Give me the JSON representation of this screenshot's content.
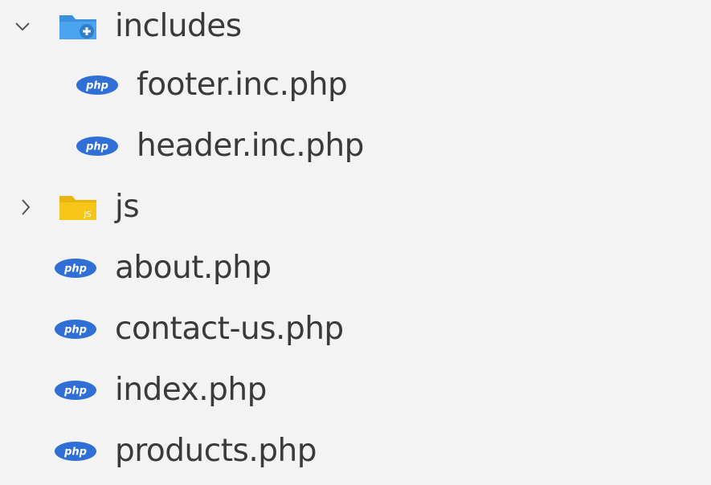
{
  "explorer": {
    "items": [
      {
        "label": "includes",
        "icon": "folder-open-icon",
        "kind": "folder",
        "expanded": true
      },
      {
        "label": "footer.inc.php",
        "icon": "php-file-icon",
        "kind": "file"
      },
      {
        "label": "header.inc.php",
        "icon": "php-file-icon",
        "kind": "file"
      },
      {
        "label": "js",
        "icon": "folder-js-icon",
        "kind": "folder",
        "expanded": false
      },
      {
        "label": "about.php",
        "icon": "php-file-icon",
        "kind": "file"
      },
      {
        "label": "contact-us.php",
        "icon": "php-file-icon",
        "kind": "file"
      },
      {
        "label": "index.php",
        "icon": "php-file-icon",
        "kind": "file"
      },
      {
        "label": "products.php",
        "icon": "php-file-icon",
        "kind": "file"
      }
    ]
  },
  "colors": {
    "background": "#f3f3f3",
    "text": "#3a3a3a",
    "php_badge": "#2f6fd6",
    "folder_includes": "#3b8fdc",
    "folder_js": "#f5c518"
  }
}
